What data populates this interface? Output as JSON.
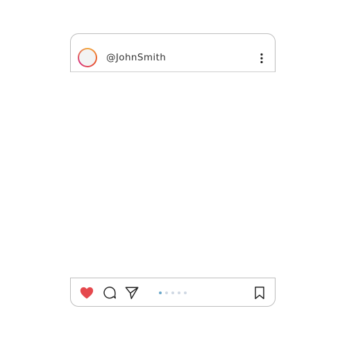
{
  "post": {
    "username": "@JohnSmith",
    "carousel": {
      "count": 5,
      "active_index": 0
    },
    "actions": {
      "like_icon": "heart-icon",
      "comment_icon": "comment-icon",
      "share_icon": "send-icon",
      "save_icon": "bookmark-icon",
      "more_icon": "more-vertical-icon"
    },
    "colors": {
      "like": "#e5484d",
      "border": "#bdbdbd",
      "indicator_active": "#6aa7c9"
    }
  }
}
